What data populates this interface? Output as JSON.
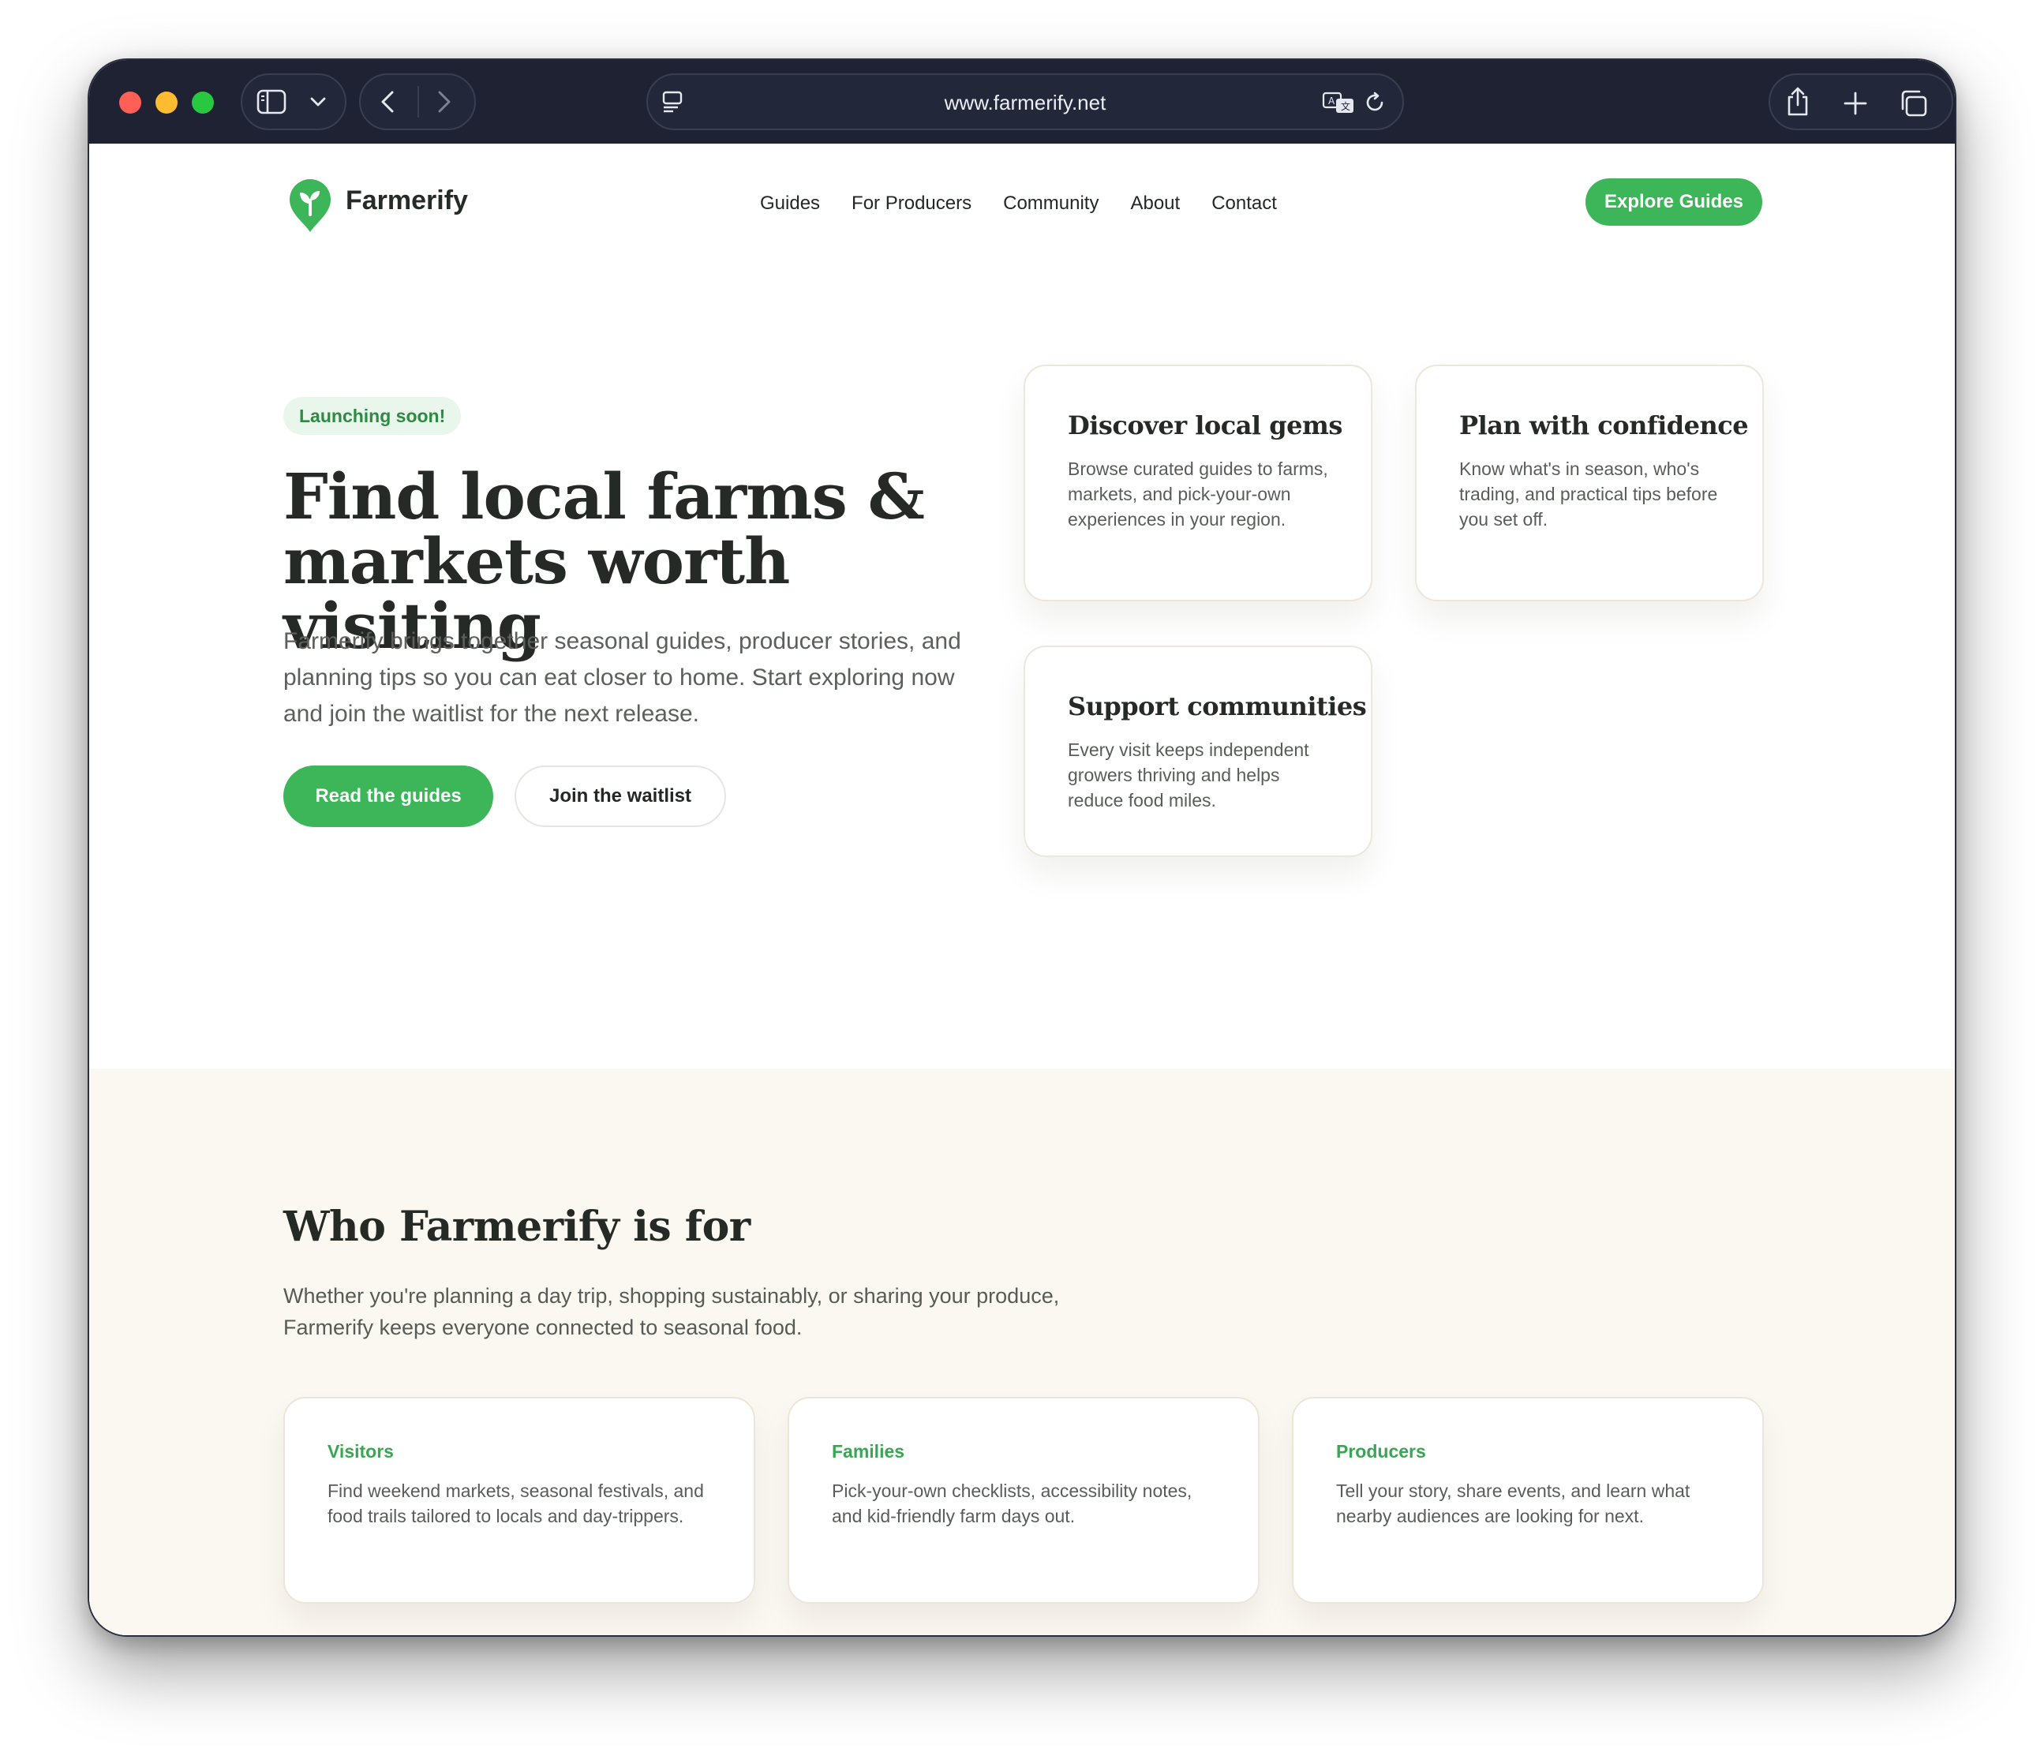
{
  "browser": {
    "url": "www.farmerify.net",
    "icons": [
      "sidebar-icon",
      "chevron-down-icon",
      "back-icon",
      "forward-icon",
      "reader-icon",
      "translate-icon",
      "reload-icon",
      "share-icon",
      "new-tab-icon",
      "tabs-icon"
    ]
  },
  "nav": {
    "brand": "Farmerify",
    "links": [
      "Guides",
      "For Producers",
      "Community",
      "About",
      "Contact"
    ],
    "cta": "Explore Guides"
  },
  "hero": {
    "badge": "Launching soon!",
    "title": "Find local farms & markets worth visiting",
    "description": "Farmerify brings together seasonal guides, producer stories, and planning tips so you can eat closer to home. Start exploring now and join the waitlist for the next release.",
    "primary_button": "Read the guides",
    "secondary_button": "Join the waitlist"
  },
  "features": [
    {
      "title": "Discover local gems",
      "text": "Browse curated guides to farms, markets, and pick-your-own experiences in your region."
    },
    {
      "title": "Plan with confidence",
      "text": "Know what's in season, who's trading, and practical tips before you set off."
    },
    {
      "title": "Support communities",
      "text": "Every visit keeps independent growers thriving and helps reduce food miles."
    }
  ],
  "audience": {
    "title": "Who Farmerify is for",
    "description": "Whether you're planning a day trip, shopping sustainably, or sharing your produce, Farmerify keeps everyone connected to seasonal food.",
    "cards": [
      {
        "title": "Visitors",
        "text": "Find weekend markets, seasonal festivals, and food trails tailored to locals and day-trippers."
      },
      {
        "title": "Families",
        "text": "Pick-your-own checklists, accessibility notes, and kid-friendly farm days out."
      },
      {
        "title": "Producers",
        "text": "Tell your story, share events, and learn what nearby audiences are looking for next."
      }
    ]
  },
  "colors": {
    "accent": "#3db65a",
    "accent_text": "#3aa653",
    "badge_bg": "#e9f6eb",
    "section_bg": "#fbf7f1",
    "titlebar": "#1f2233"
  }
}
